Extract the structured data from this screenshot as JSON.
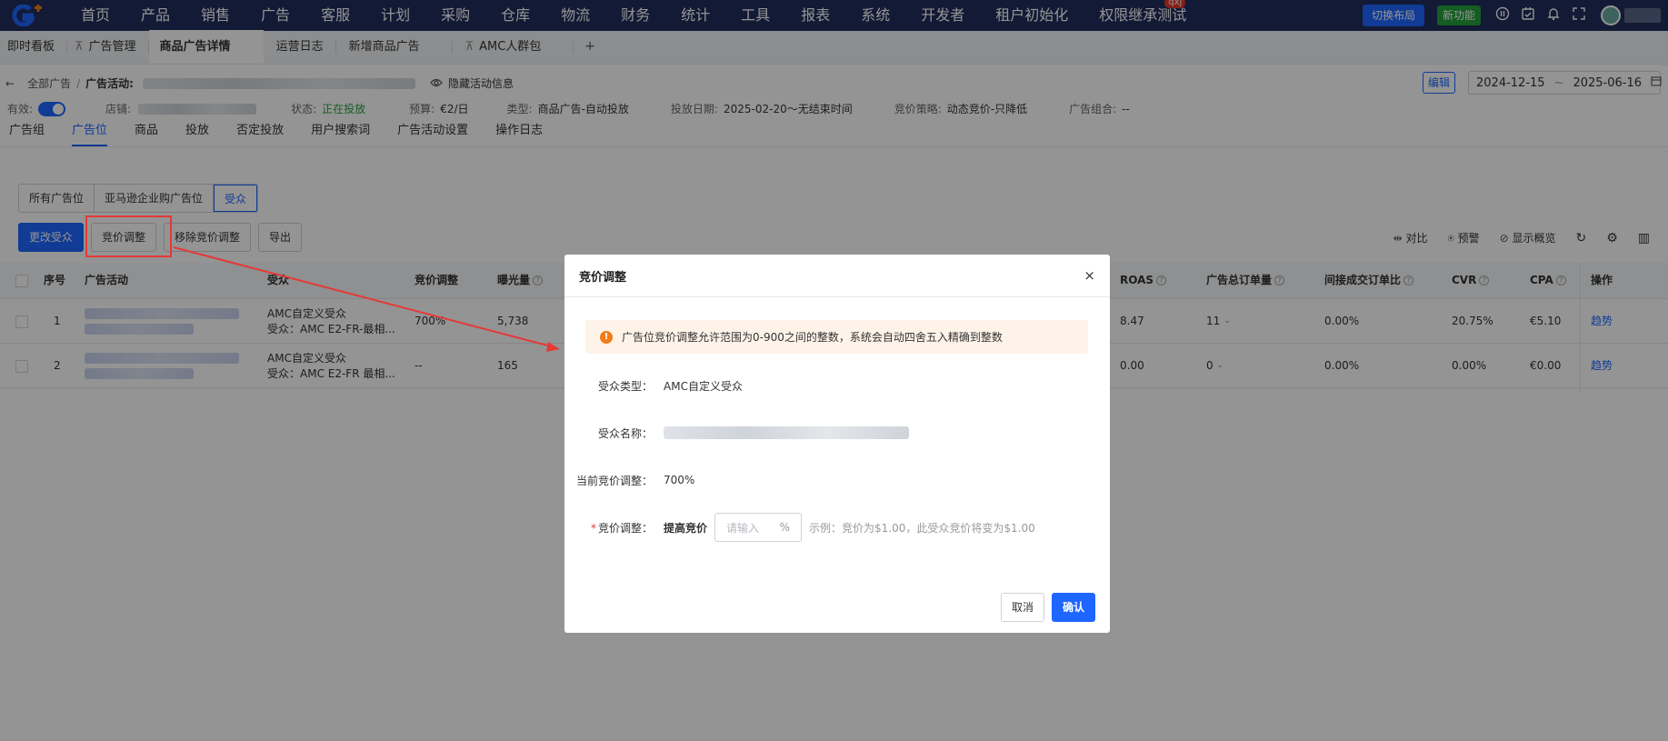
{
  "topnav": {
    "menu": [
      "首页",
      "产品",
      "销售",
      "广告",
      "客服",
      "计划",
      "采购",
      "仓库",
      "物流",
      "财务",
      "统计",
      "工具",
      "报表",
      "系统",
      "开发者",
      "租户初始化",
      "权限继承测试"
    ],
    "badge": "qxj",
    "switch_layout": "切换布局",
    "new_feature": "新功能"
  },
  "page_tabs": {
    "items": [
      "即时看板",
      "广告管理",
      "商品广告详情",
      "运营日志",
      "新增商品广告",
      "AMC人群包"
    ],
    "plus": "+"
  },
  "breadcrumb": {
    "back": "←",
    "all": "全部广告",
    "sep": "/",
    "activity_label": "广告活动:",
    "hide_info": "隐藏活动信息"
  },
  "toolbar": {
    "edit": "编辑",
    "date_start": "2024-12-15",
    "date_sep": "~",
    "date_end": "2025-06-16"
  },
  "info": {
    "valid_label": "有效:",
    "shop_label": "店铺:",
    "status_label": "状态:",
    "status_value": "正在投放",
    "budget_label": "预算:",
    "budget_value": "€2/日",
    "type_label": "类型:",
    "type_value": "商品广告-自动投放",
    "date_label": "投放日期:",
    "date_value": "2025-02-20～无结束时间",
    "strategy_label": "竞价策略:",
    "strategy_value": "动态竞价-只降低",
    "portfolio_label": "广告组合:",
    "portfolio_value": "--"
  },
  "sub_tabs": [
    "广告组",
    "广告位",
    "商品",
    "投放",
    "否定投放",
    "用户搜索词",
    "广告活动设置",
    "操作日志"
  ],
  "segments": [
    "所有广告位",
    "亚马逊企业购广告位",
    "受众"
  ],
  "actions": {
    "change_audience": "更改受众",
    "bid_adjust": "竞价调整",
    "remove_bid": "移除竞价调整",
    "export": "导出"
  },
  "tools": {
    "compare": "对比",
    "alert": "预警",
    "overview": "显示概览"
  },
  "table": {
    "headers": {
      "index": "序号",
      "campaign": "广告活动",
      "audience": "受众",
      "bid": "竞价调整",
      "impressions": "曝光量",
      "roas": "ROAS",
      "orders": "广告总订单量",
      "indirect": "间接成交订单比",
      "cvr": "CVR",
      "cpa": "CPA",
      "ops": "操作"
    },
    "rows": [
      {
        "index": "1",
        "audience_type": "AMC自定义受众",
        "audience_name": "受众：AMC E2-FR-最相...",
        "bid": "700%",
        "impressions": "5,738",
        "roas": "8.47",
        "orders": "11",
        "indirect": "0.00%",
        "cvr": "20.75%",
        "cpa": "€5.10",
        "ops": "趋势"
      },
      {
        "index": "2",
        "audience_type": "AMC自定义受众",
        "audience_name": "受众：AMC E2-FR 最相...",
        "bid": "--",
        "impressions": "165",
        "roas": "0.00",
        "orders": "0",
        "indirect": "0.00%",
        "cvr": "0.00%",
        "cpa": "€0.00",
        "ops": "趋势"
      }
    ]
  },
  "modal": {
    "title": "竞价调整",
    "close": "×",
    "alert": "广告位竞价调整允许范围为0-900之间的整数，系统会自动四舍五入精确到整数",
    "audience_type_label": "受众类型：",
    "audience_type_value": "AMC自定义受众",
    "audience_name_label": "受众名称：",
    "current_bid_label": "当前竞价调整：",
    "current_bid_value": "700%",
    "bid_label": "竞价调整：",
    "required_mark": "*",
    "raise_label": "提高竞价",
    "input_placeholder": "请输入",
    "percent": "%",
    "hint": "示例：竞价为$1.00，此受众竞价将变为$1.00",
    "cancel": "取消",
    "confirm": "确认"
  },
  "colors": {
    "nav_bg": "#1f2d5c",
    "primary": "#1e66ff",
    "success": "#25a13b",
    "danger": "#e53935",
    "warning": "#f07d1a"
  }
}
